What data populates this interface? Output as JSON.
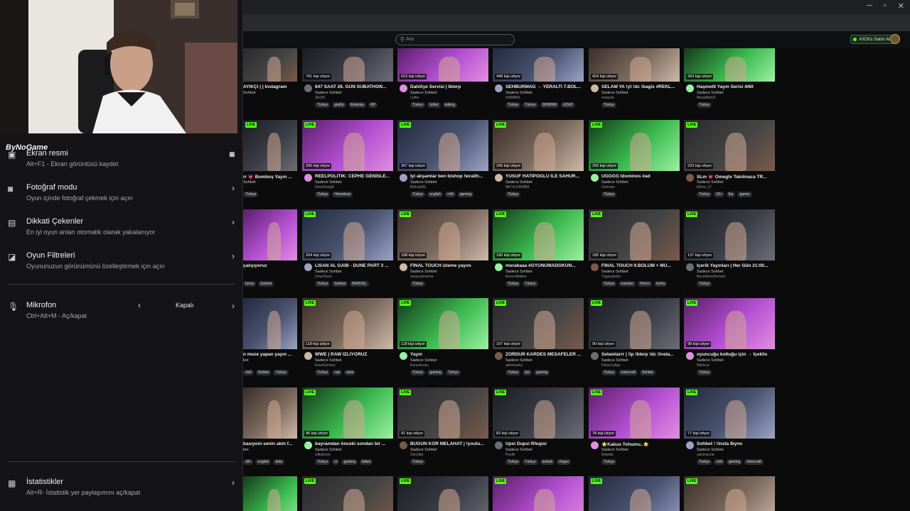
{
  "overlay": {
    "logo": "ByNoGame",
    "items": [
      {
        "title": "Ekran resmi",
        "subtitle": "Alt+F1 - Ekran görüntüsü kaydet",
        "icon": "screenshot-icon",
        "right": "camera-icon"
      },
      {
        "title": "Fotoğraf modu",
        "subtitle": "Oyun içinde fotoğraf çekmek için açın",
        "icon": "camera-icon",
        "right": "chevron-right-icon"
      },
      {
        "title": "Dikkati Çekenler",
        "subtitle": "En iyi oyun anları otomatik olarak yakalanıyor",
        "icon": "clapper-icon",
        "right": "chevron-right-icon"
      },
      {
        "title": "Oyun Filtreleri",
        "subtitle": "Oyununuzun görünümünü özelleştirmek için açın",
        "icon": "filter-icon",
        "right": "chevron-right-icon"
      }
    ],
    "mic": {
      "title": "Mikrofon",
      "subtitle": "Ctrl+Alt+M - Aç/kapat",
      "value": "Kapalı"
    },
    "stats": {
      "title": "İstatistikler",
      "subtitle": "Alt+R- İstatistik yer paylaşımını aç/kapat"
    }
  },
  "header": {
    "search_placeholder": "Ara",
    "kicks_button": "KICKs Satın Al",
    "profile_initial": "K"
  },
  "colors": {
    "accent": "#53fc18",
    "background": "#0b0b0c",
    "panel": "#141416"
  },
  "cards": [
    {
      "col": 0,
      "row": 0,
      "title": "AYIKÇI | | İnstagram",
      "cat": "Sohbet",
      "streamer": "",
      "viewers": "",
      "live": false,
      "tags": []
    },
    {
      "col": 1,
      "row": 0,
      "title": "647 SAAT 26. GÜN SUBATHON...",
      "cat": "Sadece Sohbet",
      "streamer": "ZEON",
      "viewers": "701 kişi izliyor",
      "live": false,
      "tags": [
        "Türkçe",
        "gtaRp",
        "Roleplay",
        "RP"
      ]
    },
    {
      "col": 2,
      "row": 0,
      "title": "Dahiliye Servisi | Iblerp",
      "cat": "Sadece Sohbet",
      "streamer": "Lefter",
      "viewers": "623 kişi izliyor",
      "live": false,
      "tags": [
        "Türkçe",
        "futbol",
        "talking"
      ]
    },
    {
      "col": 3,
      "row": 0,
      "title": "SEHBURMAG → YERALTI 7.BÖL...",
      "cat": "Sadece Sohbet",
      "streamer": "SHRBRK",
      "viewers": "448 kişi izliyor",
      "live": false,
      "tags": [
        "Türkçe",
        "Türkçe",
        "SHRBRK",
        "EDEP"
      ]
    },
    {
      "col": 4,
      "row": 0,
      "title": "SELAM YA !yt !dc !bagis #REKL...",
      "cat": "Sadece Sohbet",
      "streamer": "ertassia",
      "viewers": "424 kişi izliyor",
      "live": false,
      "tags": [
        "Türkçe"
      ]
    },
    {
      "col": 5,
      "row": 0,
      "title": "Haşmetli Yayın Serisi 4/60",
      "cat": "Sadece Sohbet",
      "streamer": "MuratAbiGF",
      "viewers": "393 kişi izliyor",
      "live": false,
      "tags": [
        "Türkçe"
      ]
    },
    {
      "col": 0,
      "row": 1,
      "title": "rr 💗 Bomboş Yayın ...",
      "cat": "Sohbet",
      "streamer": "",
      "viewers": "",
      "live": true,
      "tags": [
        "Türkçe"
      ]
    },
    {
      "col": 1,
      "row": 1,
      "title": "REELPOLITIK: CEPHE GENISLE...",
      "cat": "Sadece Sohbet",
      "streamer": "DenizKargili",
      "viewers": "330 kişi izliyor",
      "live": true,
      "tags": [
        "Türkçe",
        "Hürmekan"
      ]
    },
    {
      "col": 2,
      "row": 1,
      "title": "İyi akşamlar ben bishop !wraith...",
      "cat": "Sadece Sohbet",
      "streamer": "BishopIRL",
      "viewers": "307 kişi izliyor",
      "live": true,
      "tags": [
        "Türkçe",
        "english",
        "chill",
        "gaming"
      ]
    },
    {
      "col": 3,
      "row": 1,
      "title": "YUSUF HATİPOĞLU İLE SAHUR...",
      "cat": "Sadece Sohbet",
      "streamer": "MKYILDIRIMM",
      "viewers": "299 kişi izliyor",
      "live": true,
      "tags": [
        "Türkçe"
      ]
    },
    {
      "col": 4,
      "row": 1,
      "title": "UĞĞĞĞ Idominos #ad",
      "cat": "Sadece Sohbet",
      "streamer": "Grimnax",
      "viewers": "293 kişi izliyor",
      "live": true,
      "tags": [
        "Türkçe"
      ]
    },
    {
      "col": 5,
      "row": 1,
      "title": "SLm 💗 Omegtv Takılmaca TR...",
      "cat": "Sadece Sohbet",
      "streamer": "ERoo_17",
      "viewers": "233 kişi izliyor",
      "live": true,
      "tags": [
        "Türkçe",
        "18+",
        "fps",
        "gamer"
      ]
    },
    {
      "col": 0,
      "row": 2,
      "title": "çalışıyoruz",
      "cat": "",
      "streamer": "",
      "viewers": "",
      "live": false,
      "tags": [
        "funny",
        "Sohbet"
      ]
    },
    {
      "col": 1,
      "row": 2,
      "title": "LİSAN AL GAİB - DUNE PART 3 ...",
      "cat": "Sadece Sohbet",
      "streamer": "UmutTezer",
      "viewers": "204 kişi izliyor",
      "live": true,
      "tags": [
        "Türkçe",
        "Sohbet",
        "MARVEL"
      ]
    },
    {
      "col": 2,
      "row": 2,
      "title": "FINAL TOUCH izleme yayını",
      "cat": "Sadece Sohbet",
      "streamer": "muazzamsena",
      "viewers": "198 kişi izliyor",
      "live": true,
      "tags": [
        "Türkçe"
      ]
    },
    {
      "col": 3,
      "row": 2,
      "title": "merabaaa #OYUNUMADOKUN...",
      "cat": "Sadece Sohbet",
      "streamer": "KeremWalker",
      "viewers": "190 kişi izliyor",
      "live": true,
      "tags": [
        "Türkçe",
        "Türkçe"
      ]
    },
    {
      "col": 4,
      "row": 2,
      "title": "FINAL TOUCH 9.BÖLÜM + MU...",
      "cat": "Sadece Sohbet",
      "streamer": "Tugayakdnz",
      "viewers": "185 kişi izliyor",
      "live": true,
      "tags": [
        "Türkçe",
        "reaction",
        "Horror",
        "korku"
      ]
    },
    {
      "col": 5,
      "row": 2,
      "title": "İçerik Yayınları | Her Gün 21:00...",
      "cat": "Sadece Sohbet",
      "streamer": "BecerikisizRoma0",
      "viewers": "137 kişi izliyor",
      "live": true,
      "tags": [
        "Türkçe"
      ]
    },
    {
      "col": 0,
      "row": 3,
      "title": "n meze yapan yayın ...",
      "cat": "bet",
      "streamer": "",
      "viewers": "",
      "live": false,
      "tags": [
        "chill",
        "Sohbet",
        "Türkçe"
      ]
    },
    {
      "col": 1,
      "row": 3,
      "title": "WWE | RAW İZLİYORUZ",
      "cat": "Sadece Sohbet",
      "streamer": "EnesGonenc",
      "viewers": "118 kişi izliyor",
      "live": true,
      "tags": [
        "Türkçe",
        "raw",
        "wwe"
      ]
    },
    {
      "col": 2,
      "row": 3,
      "title": "Yayın",
      "cat": "Sadece Sohbet",
      "streamer": "Konsolussu",
      "viewers": "118 kişi izliyor",
      "live": true,
      "tags": [
        "Türkçe",
        "gaming",
        "Türkçe"
      ]
    },
    {
      "col": 3,
      "row": 3,
      "title": "ZORDUR KARDES MESAFELER ...",
      "cat": "Sadece Sohbet",
      "streamer": "aphebucky",
      "viewers": "107 kişi izliyor",
      "live": true,
      "tags": [
        "Türkçe",
        "fps",
        "gaming"
      ]
    },
    {
      "col": 4,
      "row": 3,
      "title": "Selamlarrr | !ip !blerp !dc !insta...",
      "cat": "Sadece Sohbet",
      "streamer": "DeissCallgo",
      "viewers": "90 kişi izliyor",
      "live": true,
      "tags": [
        "Türkçe",
        "minecraft",
        "Sohbet"
      ]
    },
    {
      "col": 5,
      "row": 3,
      "title": "oyuncuğu koltuğu için → İçeklis",
      "cat": "Sadece Sohbet",
      "streamer": "Werlicia",
      "viewers": "98 kişi izliyor",
      "live": true,
      "tags": [
        "Türkçe"
      ]
    },
    {
      "col": 0,
      "row": 4,
      "title": "basıyom senin akin f...",
      "cat": "bet",
      "streamer": "",
      "viewers": "",
      "live": false,
      "tags": [
        "18+",
        "english",
        "dota"
      ]
    },
    {
      "col": 1,
      "row": 4,
      "title": "bayramdan önceki sondan bir ...",
      "cat": "Sadece Sohbet",
      "streamer": "UlkuEmre",
      "viewers": "96 kişi izliyor",
      "live": true,
      "tags": [
        "Türkçe",
        "ırl",
        "gaming",
        "futbol"
      ]
    },
    {
      "col": 2,
      "row": 4,
      "title": "BUGÜN KÖR MELAHAT | !youtu...",
      "cat": "Sadece Sohbet",
      "streamer": "Oscollat",
      "viewers": "91 kişi izliyor",
      "live": true,
      "tags": [
        "Türkçe"
      ]
    },
    {
      "col": 3,
      "row": 4,
      "title": "Upsi Dupsi Rhupsi",
      "cat": "Sadece Sohbet",
      "streamer": "Pusilli",
      "viewers": "83 kişi izliyor",
      "live": true,
      "tags": [
        "Türkçe",
        "Türkçe",
        "turkish",
        "rhupsi"
      ]
    },
    {
      "col": 4,
      "row": 4,
      "title": "⭐Kabus Tohumu..⭐",
      "cat": "Sadece Sohbet",
      "streamer": "Elfardie",
      "viewers": "78 kişi izliyor",
      "live": true,
      "tags": [
        "Türkçe"
      ]
    },
    {
      "col": 5,
      "row": 4,
      "title": "Sohbet ! !insta Ibyno",
      "cat": "Sadece Sohbet",
      "streamer": "yalcinsezar",
      "viewers": "77 kişi izliyor",
      "live": true,
      "tags": [
        "Türkçe",
        "chill",
        "gaming",
        "minecraft"
      ]
    },
    {
      "col": 0,
      "row": 5,
      "title": "",
      "cat": "",
      "streamer": "",
      "viewers": "",
      "live": false,
      "tags": []
    },
    {
      "col": 1,
      "row": 5,
      "title": "",
      "cat": "",
      "streamer": "",
      "viewers": "",
      "live": true,
      "tags": []
    },
    {
      "col": 2,
      "row": 5,
      "title": "",
      "cat": "",
      "streamer": "",
      "viewers": "",
      "live": true,
      "tags": []
    },
    {
      "col": 3,
      "row": 5,
      "title": "",
      "cat": "",
      "streamer": "",
      "viewers": "",
      "live": true,
      "tags": []
    },
    {
      "col": 4,
      "row": 5,
      "title": "",
      "cat": "",
      "streamer": "",
      "viewers": "",
      "live": true,
      "tags": []
    },
    {
      "col": 5,
      "row": 5,
      "title": "",
      "cat": "",
      "streamer": "",
      "viewers": "",
      "live": true,
      "tags": []
    }
  ]
}
